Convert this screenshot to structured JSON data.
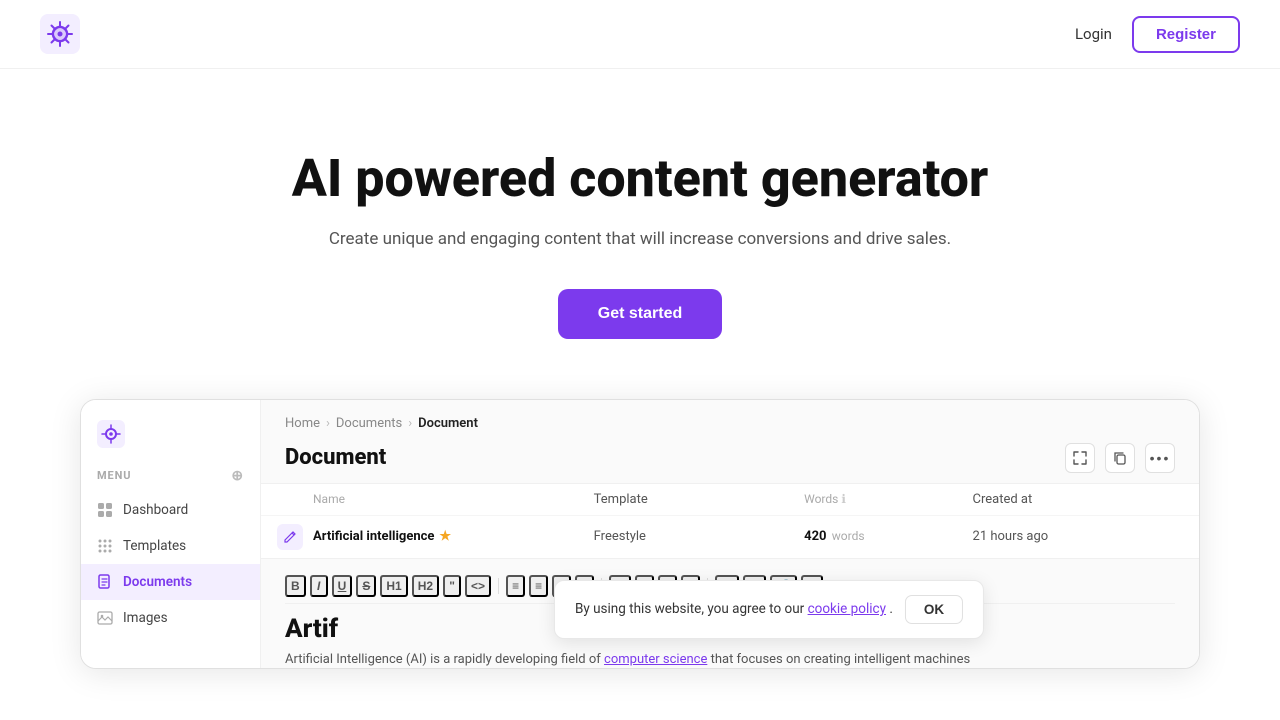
{
  "header": {
    "login_label": "Login",
    "register_label": "Register"
  },
  "hero": {
    "title": "AI powered content generator",
    "subtitle": "Create unique and engaging content that will increase conversions and drive sales.",
    "cta_label": "Get started"
  },
  "sidebar": {
    "menu_label": "MENU",
    "items": [
      {
        "id": "dashboard",
        "label": "Dashboard",
        "icon": "grid"
      },
      {
        "id": "templates",
        "label": "Templates",
        "icon": "grid-small"
      },
      {
        "id": "documents",
        "label": "Documents",
        "icon": "doc",
        "active": true
      },
      {
        "id": "images",
        "label": "Images",
        "icon": "image"
      }
    ]
  },
  "breadcrumb": {
    "items": [
      "Home",
      "Documents",
      "Document"
    ],
    "active": "Document"
  },
  "document": {
    "title": "Document",
    "actions": [
      "fullscreen",
      "copy",
      "more"
    ]
  },
  "table": {
    "headers": [
      "",
      "Name",
      "Template",
      "Words",
      "Created at"
    ],
    "row": {
      "name": "Artificial intelligence",
      "starred": true,
      "template": "Freestyle",
      "words": "420",
      "words_label": "words",
      "created": "21 hours ago"
    }
  },
  "editor": {
    "toolbar_items": [
      "B",
      "I",
      "U",
      "S",
      "H1",
      "H2",
      "\"",
      "<>",
      "|",
      "≡",
      "≡",
      "≡",
      "≡",
      "|",
      "↵",
      "≡",
      "≡",
      "≡",
      "|",
      "x₂",
      "x²",
      "🔗",
      "✗"
    ],
    "doc_title": "Artif",
    "doc_body_start": "Artificial Intelligence (AI) is a rapidly developing field of",
    "doc_body_link": "computer science",
    "doc_body_end": "that focuses on creating intelligent machines"
  },
  "cookie_banner": {
    "text_before": "By using this website, you agree to our",
    "link_text": "cookie policy",
    "text_after": ".",
    "ok_label": "OK"
  },
  "template_freestyle": {
    "label": "Template Freestyle"
  }
}
